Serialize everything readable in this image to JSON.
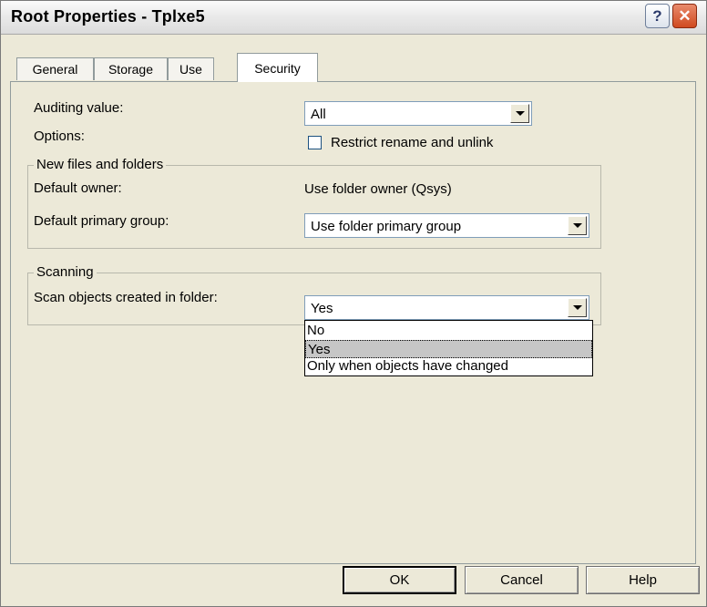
{
  "window": {
    "title": "Root Properties - Tplxe5",
    "help_glyph": "?",
    "close_glyph": "✕"
  },
  "tabs": [
    {
      "label": "General",
      "active": false
    },
    {
      "label": "Storage",
      "active": false
    },
    {
      "label": "Use",
      "active": false
    },
    {
      "label": "Security",
      "active": true
    }
  ],
  "security": {
    "auditing_label": "Auditing value:",
    "auditing_value": "All",
    "options_label": "Options:",
    "restrict_label": "Restrict rename and unlink",
    "restrict_checked": false,
    "new_files_group": {
      "title": "New files and folders",
      "default_owner_label": "Default owner:",
      "default_owner_value": "Use folder owner (Qsys)",
      "primary_group_label": "Default primary group:",
      "primary_group_value": "Use folder primary group"
    },
    "scanning_group": {
      "title": "Scanning",
      "scan_label": "Scan objects created in folder:",
      "scan_value": "Yes",
      "scan_options": [
        "No",
        "Yes",
        "Only when objects have changed"
      ],
      "selected_option": "Yes"
    }
  },
  "buttons": {
    "ok": "OK",
    "cancel": "Cancel",
    "help": "Help"
  },
  "colors": {
    "dialog_bg": "#ece9d8",
    "close_button": "#d04a1f",
    "selection": "#c6c6c6"
  }
}
